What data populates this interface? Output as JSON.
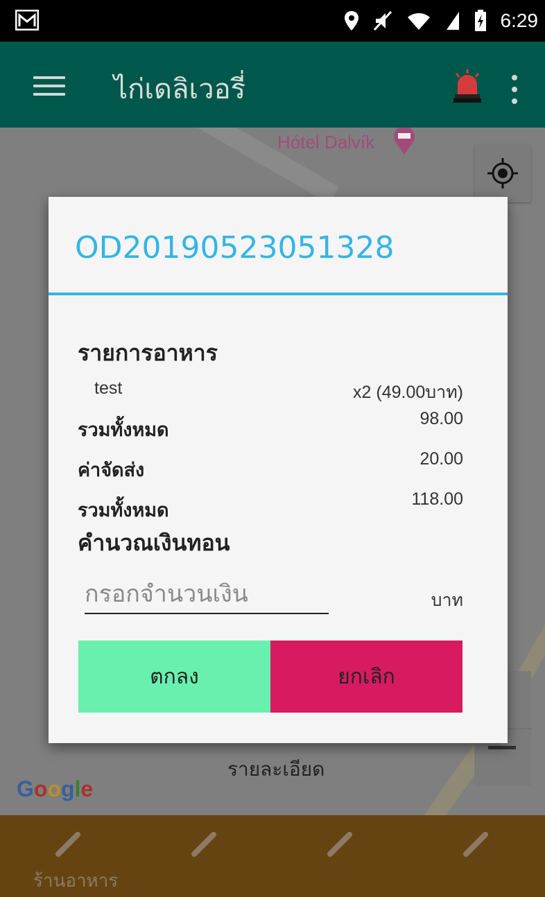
{
  "status_bar": {
    "time": "6:29"
  },
  "app_bar": {
    "title": "ไก่เดลิเวอรี่"
  },
  "map": {
    "place_label": "Hótel Dalvík",
    "detail_label": "รายละเอียด",
    "logo": "Google"
  },
  "bottom_nav": {
    "items": [
      {
        "label": "ร้านอาหาร"
      },
      {
        "label": ""
      },
      {
        "label": ""
      },
      {
        "label": ""
      }
    ]
  },
  "dialog": {
    "order_id": "OD20190523051328",
    "food_header": "รายการอาหาร",
    "items": [
      {
        "name": "test",
        "qty_price": "x2 (49.00บาท)"
      }
    ],
    "subtotal_label": "รวมทั้งหมด",
    "subtotal_value": "98.00",
    "delivery_label": "ค่าจัดส่ง",
    "delivery_value": "20.00",
    "total_label": "รวมทั้งหมด",
    "total_value": "118.00",
    "change_header": "คำนวณเงินทอน",
    "amount_placeholder": "กรอกจำนวนเงิน",
    "currency_unit": "บาท",
    "ok_label": "ตกลง",
    "cancel_label": "ยกเลิก"
  },
  "colors": {
    "app_bar": "#00574B",
    "accent": "#33b5e5",
    "ok_button": "#69f0ae",
    "cancel_button": "#d81b60",
    "bottom_nav": "#664411"
  },
  "icons": [
    "gmail-icon",
    "location-icon",
    "mute-icon",
    "wifi-icon",
    "signal-icon",
    "battery-icon",
    "menu-icon",
    "siren-icon",
    "more-icon",
    "hotel-pin-icon",
    "gps-icon",
    "pencil-icon"
  ]
}
